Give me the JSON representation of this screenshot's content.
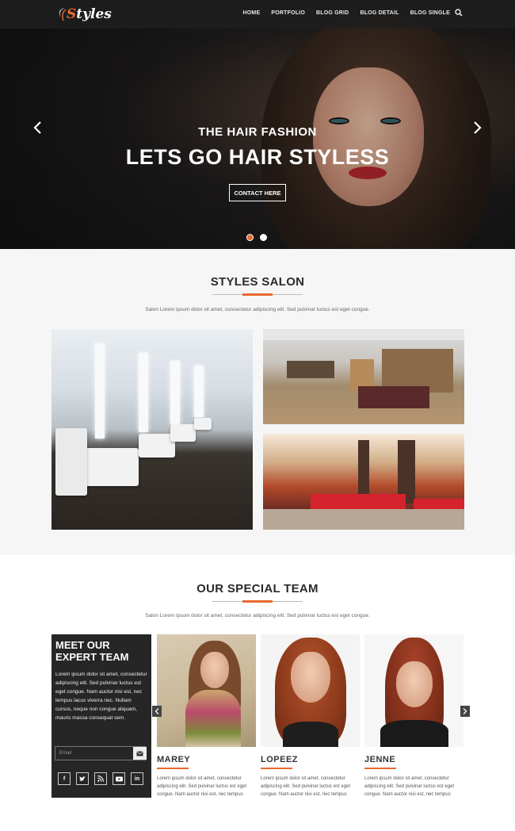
{
  "brand": {
    "logo_first": "S",
    "logo_rest": "tyles",
    "accent": "#e8692d"
  },
  "nav": {
    "items": [
      {
        "label": "HOME"
      },
      {
        "label": "PORTFOLIO"
      },
      {
        "label": "BLOG GRID"
      },
      {
        "label": "BLOG DETAIL"
      },
      {
        "label": "BLOG SINGLE"
      }
    ],
    "search_icon": "search-icon"
  },
  "hero": {
    "subtitle": "THE HAIR FASHION",
    "title": "LETS GO HAIR STYLESS",
    "button": "CONTACT HERE",
    "slides": 2,
    "active_slide": 1
  },
  "salon": {
    "title": "STYLES SALON",
    "description": "Salon Lorem ipsum dolor sit amet, consectetur adipiscing elit. Sed pulvinar luctus est eget congue."
  },
  "team": {
    "title": "OUR SPECIAL TEAM",
    "description": "Salon Lorem ipsum dolor sit amet, consectetur adipiscing elit. Sed pulvinar luctus est eget congue.",
    "card": {
      "heading_line1": "MEET OUR",
      "heading_line2": "EXPERT TEAM",
      "text": "Lorem ipsum dolor sit amet, consectetur adipiscing elit. Sed pulvinar luctus est eget congue. Nam auctor nisi est, nec tempus lacus viverra nec. Nullam cursus, neque non congue aliquam, mauris massa consequat sem.",
      "email_placeholder": "Email",
      "socials": [
        "f",
        "t",
        "rss",
        "yt",
        "in"
      ]
    },
    "members": [
      {
        "name": "MAREY",
        "bio": "Lorem ipsum dolor sit amet, consectetur adipiscing elit. Sed pulvinar luctus est eget congue. Nam auctor nisi est, nec tempus"
      },
      {
        "name": "LOPEEZ",
        "bio": "Lorem ipsum dolor sit amet, consectetur adipiscing elit. Sed pulvinar luctus est eget congue. Nam auctor nisi est, nec tempus"
      },
      {
        "name": "JENNE",
        "bio": "Lorem ipsum dolor sit amet, consectetur adipiscing elit. Sed pulvinar luctus est eget congue. Nam auctor nisi est, nec tempus"
      }
    ]
  }
}
